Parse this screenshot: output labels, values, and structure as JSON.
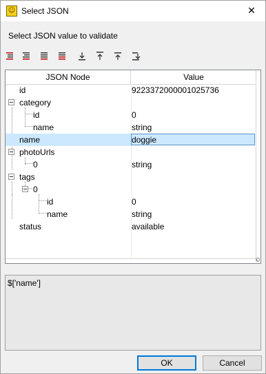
{
  "window": {
    "title": "Select JSON"
  },
  "header": {
    "subtitle": "Select JSON value to validate"
  },
  "toolbar": {
    "buttons": [
      {
        "icon": "expand-all-icon"
      },
      {
        "icon": "expand-icon"
      },
      {
        "icon": "collapse-icon"
      },
      {
        "icon": "collapse-all-icon"
      },
      {
        "icon": "move-bottom-icon"
      },
      {
        "icon": "move-top-icon"
      },
      {
        "icon": "move-up-icon"
      },
      {
        "icon": "move-down-icon"
      }
    ]
  },
  "tree": {
    "columns": [
      "JSON Node",
      "Value"
    ],
    "rows": [
      {
        "node": "id",
        "value": "9223372000001025736"
      },
      {
        "node": "category",
        "value": ""
      },
      {
        "node": "id",
        "value": "0"
      },
      {
        "node": "name",
        "value": "string"
      },
      {
        "node": "name",
        "value": "doggie"
      },
      {
        "node": "photoUrls",
        "value": ""
      },
      {
        "node": "0",
        "value": "string"
      },
      {
        "node": "tags",
        "value": ""
      },
      {
        "node": "0",
        "value": ""
      },
      {
        "node": "id",
        "value": "0"
      },
      {
        "node": "name",
        "value": "string"
      },
      {
        "node": "status",
        "value": "available"
      }
    ]
  },
  "output": {
    "path": "$['name']"
  },
  "buttons": {
    "ok": "OK",
    "cancel": "Cancel"
  }
}
